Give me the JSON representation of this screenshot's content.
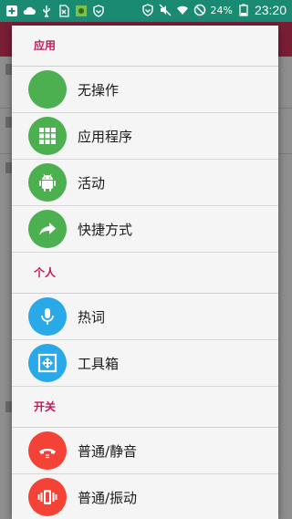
{
  "status_bar": {
    "battery": "24%",
    "time": "23:20"
  },
  "sections": [
    {
      "title": "应用",
      "items": [
        {
          "label": "无操作",
          "icon": "none-icon",
          "color": "#4caf50"
        },
        {
          "label": "应用程序",
          "icon": "apps-grid-icon",
          "color": "#4caf50"
        },
        {
          "label": "活动",
          "icon": "android-icon",
          "color": "#4caf50"
        },
        {
          "label": "快捷方式",
          "icon": "share-arrow-icon",
          "color": "#4caf50"
        }
      ]
    },
    {
      "title": "个人",
      "items": [
        {
          "label": "热词",
          "icon": "microphone-icon",
          "color": "#29a9e8"
        },
        {
          "label": "工具箱",
          "icon": "toolbox-icon",
          "color": "#29a9e8"
        }
      ]
    },
    {
      "title": "开关",
      "items": [
        {
          "label": "普通/静音",
          "icon": "phone-hangup-icon",
          "color": "#f44336"
        },
        {
          "label": "普通/振动",
          "icon": "vibrate-icon",
          "color": "#f44336"
        }
      ]
    }
  ]
}
